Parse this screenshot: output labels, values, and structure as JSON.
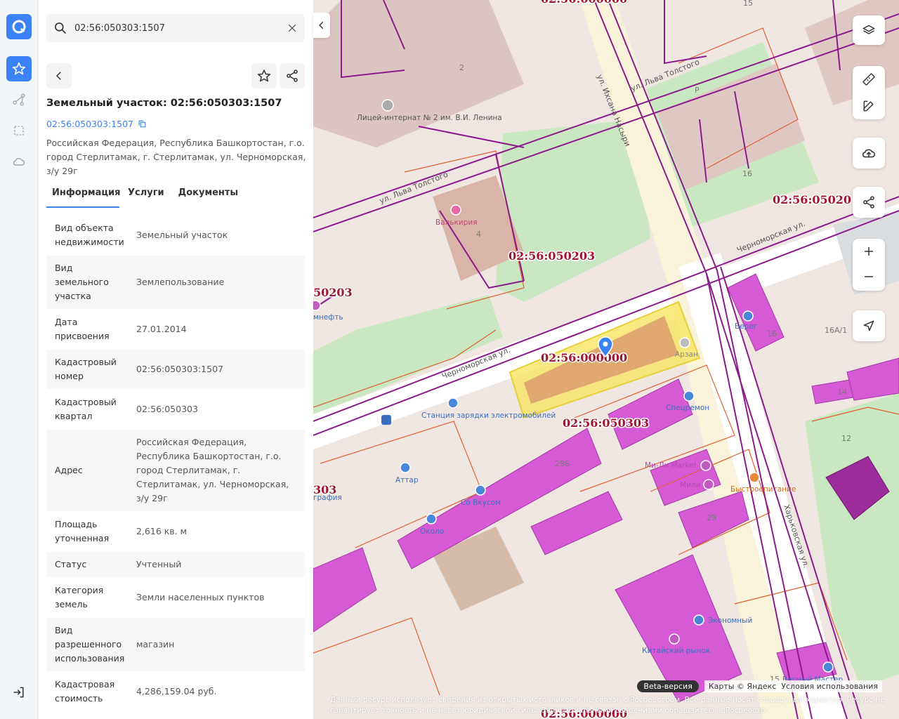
{
  "search": {
    "value": "02:56:050303:1507"
  },
  "panel": {
    "title": "Земельный участок: 02:56:050303:1507",
    "cadastral_link": "02:56:050303:1507",
    "address": "Российская Федерация, Республика Башкортостан, г.о. город Стерлитамак, г. Стерлитамак, ул. Черноморская, з/у 29г",
    "tabs": [
      {
        "label": "Информация",
        "active": true
      },
      {
        "label": "Услуги",
        "active": false
      },
      {
        "label": "Документы",
        "active": false
      }
    ],
    "properties": [
      {
        "key": "Вид объекта недвижимости",
        "value": "Земельный участок"
      },
      {
        "key": "Вид земельного участка",
        "value": "Землепользование"
      },
      {
        "key": "Дата присвоения",
        "value": "27.01.2014"
      },
      {
        "key": "Кадастровый номер",
        "value": "02:56:050303:1507"
      },
      {
        "key": "Кадастровый квартал",
        "value": "02:56:050303"
      },
      {
        "key": "Адрес",
        "value": "Российская Федерация, Республика Башкортостан, г.о. город Стерлитамак, г. Стерлитамак, ул. Черноморская, з/у 29г"
      },
      {
        "key": "Площадь уточненная",
        "value": "2,616 кв. м"
      },
      {
        "key": "Статус",
        "value": "Учтенный"
      },
      {
        "key": "Категория земель",
        "value": "Земли населенных пунктов"
      },
      {
        "key": "Вид разрешенного использования",
        "value": "магазин"
      },
      {
        "key": "Кадастровая стоимость",
        "value": "4,286,159.04 руб."
      }
    ]
  },
  "map": {
    "quarter_labels": [
      "02:56:050203",
      "02:56:050303",
      "02:56:000000",
      "02:56:05020",
      "50203",
      "303",
      "02:56:000000",
      "02:56:000000"
    ],
    "street_labels": [
      "ул. Ихсана Насыри",
      "ул. Льва Толстого",
      "Черноморская ул.",
      "Черноморская ул.",
      "Харьковская ул.",
      "ул. Льва Толстого"
    ],
    "places": [
      "Лицей-интернат № 2 им. В.И. Ленина",
      "Валькирия",
      "Станция зарядки электромобилей",
      "Аттар",
      "Со Вкусом",
      "Около",
      "Спецремон",
      "Ми-Ли Market",
      "Мили",
      "Быстроепитание",
      "Экономный",
      "Китайский рынок",
      "Верный Мастер",
      "Арзан",
      "мнефть",
      "графия",
      "Берег"
    ],
    "house_numbers": [
      "2",
      "4",
      "16",
      "16",
      "16А/1",
      "14",
      "12",
      "29Б",
      "29",
      "15",
      "15",
      "Р"
    ],
    "beta_label": "Beta-версия",
    "attribution": "Карты © Яндекс",
    "terms": "Условия использования",
    "disclaimer": "Данный ресурс использует сведения из открытых источников и не связан с Росреестром. Все данные носят справочный характер. Ресурс не гарантирует точность и не несет юридической силы. За официальными сведениями обращайтесь в Росреестр."
  },
  "colors": {
    "accent": "#3b82f6",
    "boundary": "#8b1a8b",
    "parcel": "#e06030",
    "selected": "#f7e463",
    "commercial": "#d65ad6"
  }
}
